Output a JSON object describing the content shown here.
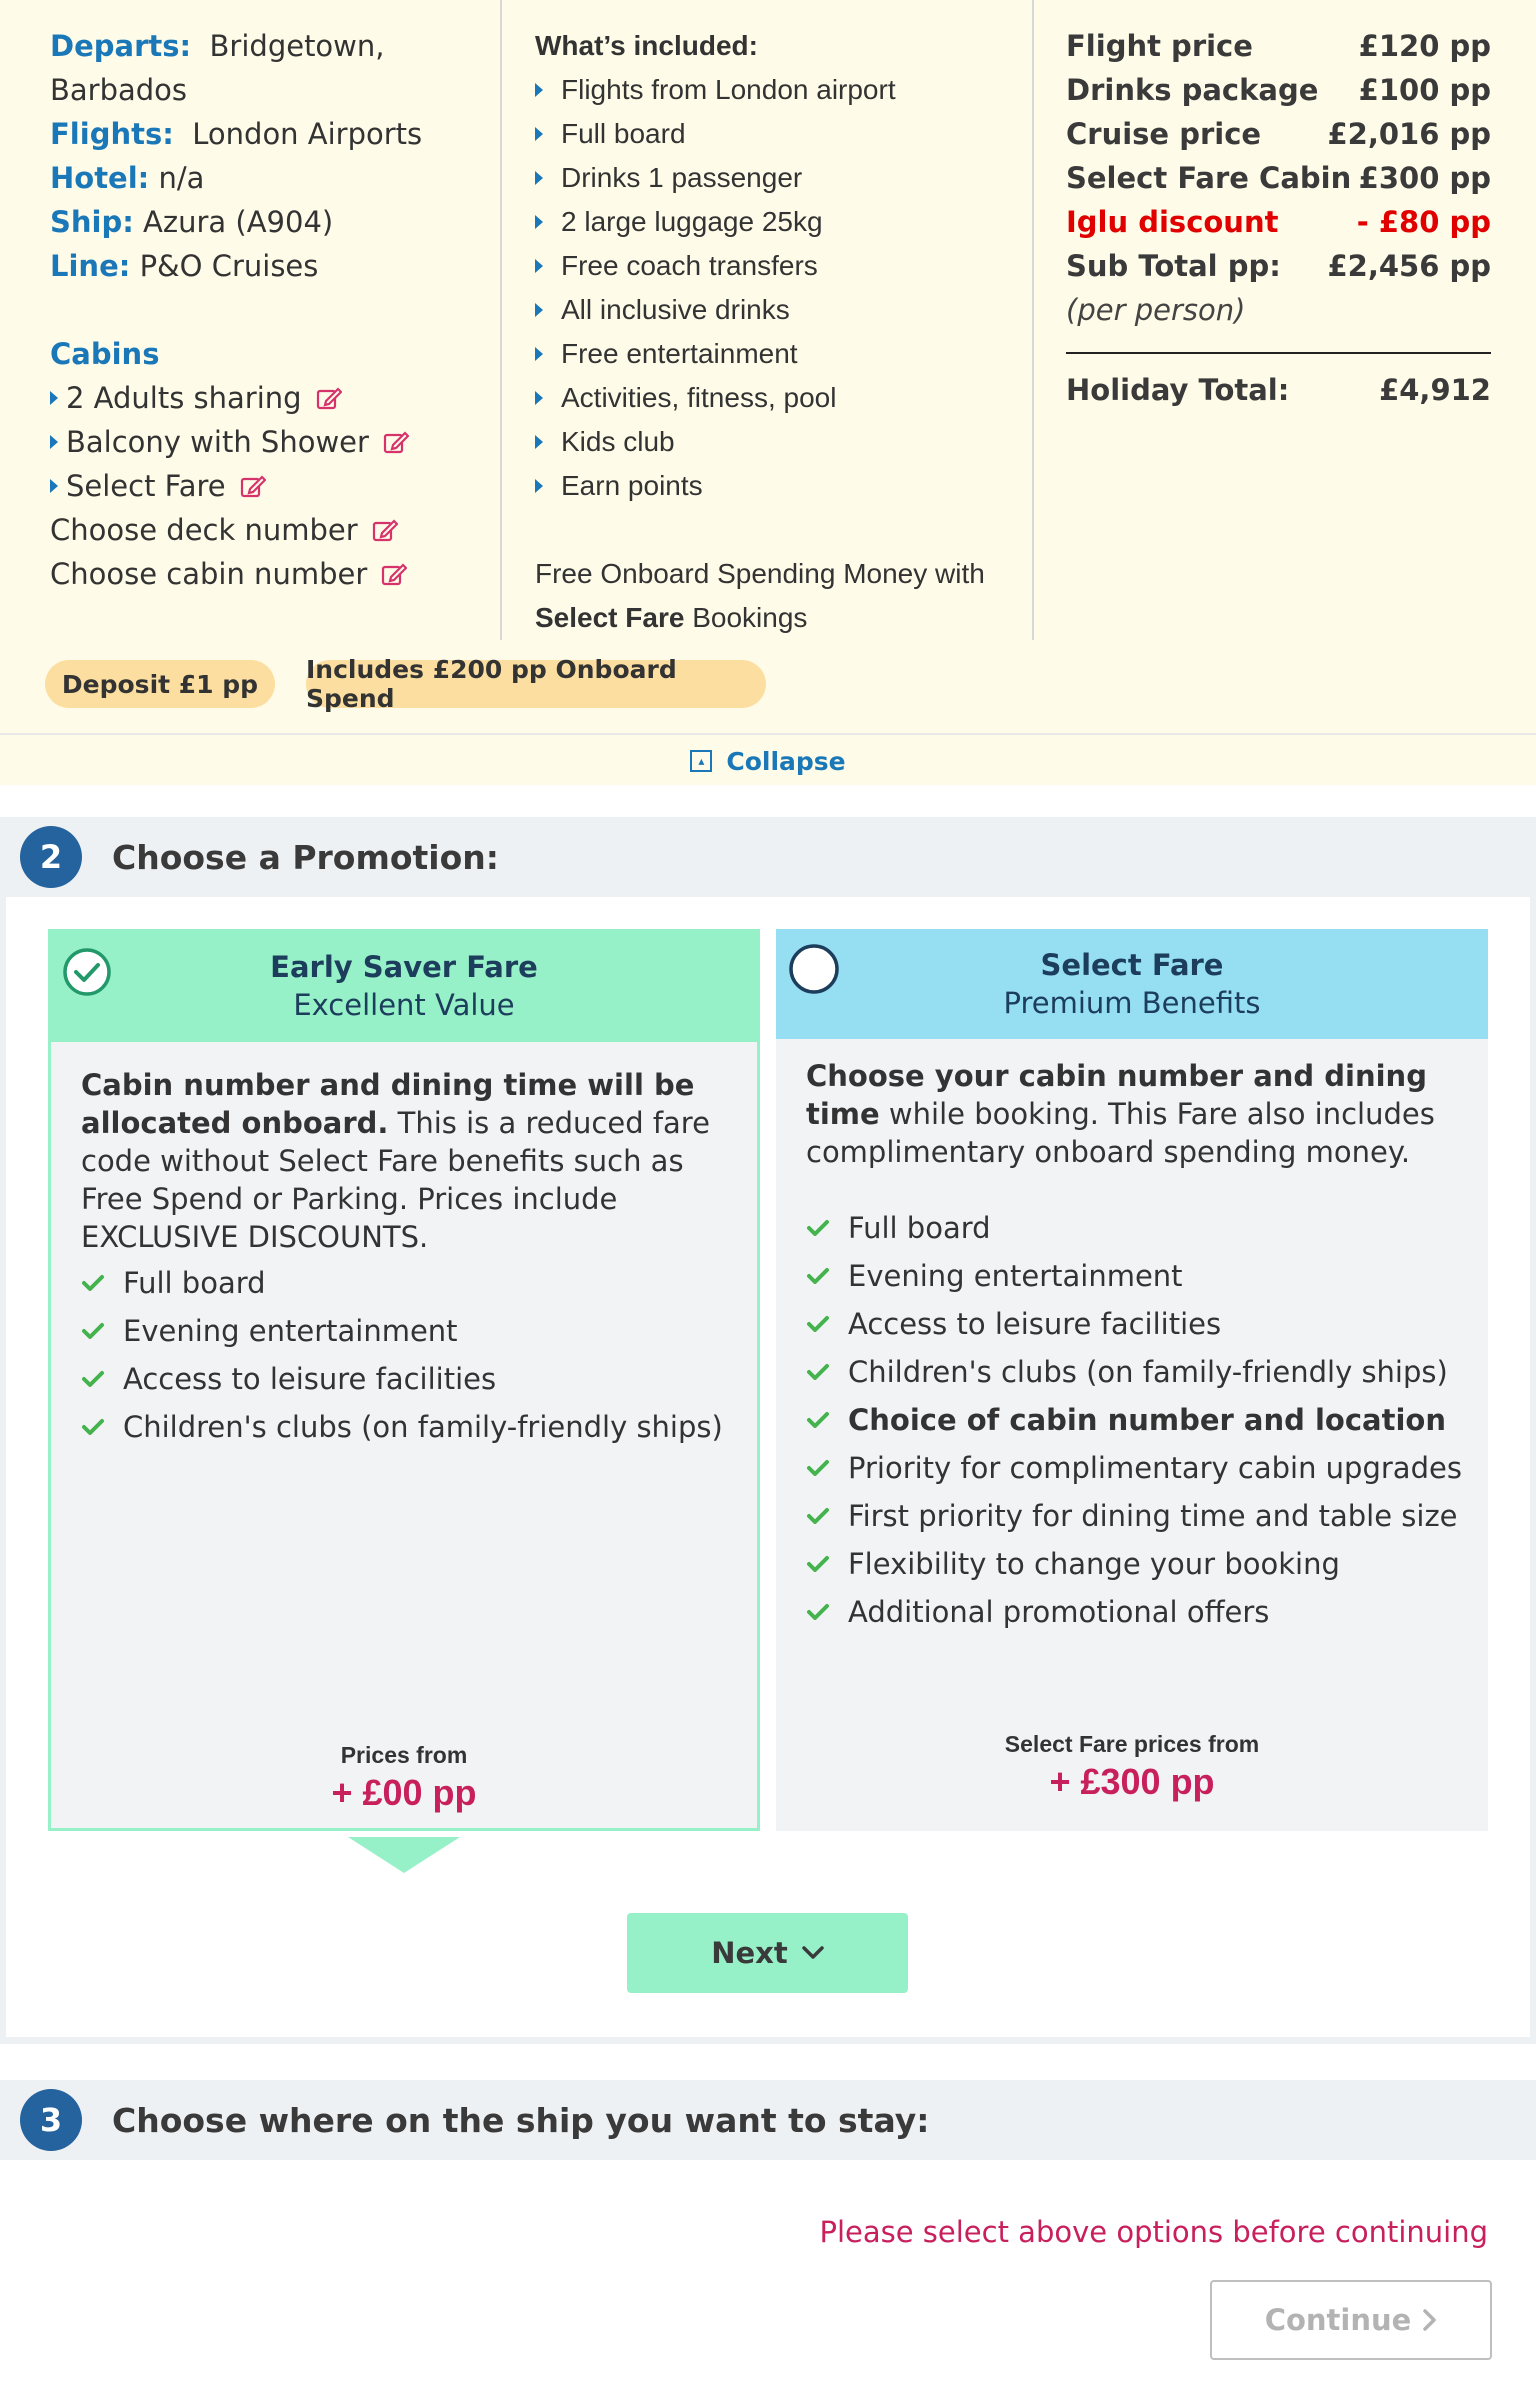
{
  "summary": {
    "details": [
      {
        "label": "Departs:",
        "value": "Bridgetown, Barbados"
      },
      {
        "label": "Flights:",
        "value": "London Airports"
      },
      {
        "label": "Hotel:",
        "value": "n/a"
      },
      {
        "label": "Ship:",
        "value": "Azura (A904)"
      },
      {
        "label": "Line:",
        "value": "P&O Cruises"
      }
    ],
    "cabins_title": "Cabins",
    "cabins": [
      "2 Adults sharing",
      "Balcony with Shower",
      "Select Fare",
      "Choose deck number",
      "Choose cabin number"
    ],
    "included_title": "What’s included:",
    "included": [
      "Flights from London airport",
      "Full board",
      "Drinks 1 passenger",
      "2 large luggage 25kg",
      "Free coach transfers",
      "All inclusive drinks",
      "Free entertainment",
      "Activities, fitness, pool",
      "Kids club",
      "Earn points"
    ],
    "onboard_note_1": "Free Onboard Spending Money with",
    "onboard_note_bold": "Select Fare",
    "onboard_note_2": " Bookings",
    "prices": [
      {
        "label": "Flight price",
        "value": "£120 pp"
      },
      {
        "label": "Drinks package",
        "value": "£100 pp"
      },
      {
        "label": "Cruise price",
        "value": "£2,016 pp"
      },
      {
        "label": "Select Fare Cabin",
        "value": "£300 pp"
      },
      {
        "label": "Iglu discount",
        "value": "- £80 pp"
      },
      {
        "label": "Sub Total pp:",
        "value": "£2,456 pp"
      }
    ],
    "per_person": "(per person)",
    "holiday_total_label": "Holiday Total:",
    "holiday_total_value": "£4,912",
    "deposit_pill": "Deposit £1 pp",
    "onboard_pill": "Includes £200 pp Onboard Spend",
    "collapse_label": "Collapse"
  },
  "step2": {
    "number": "2",
    "title": "Choose a Promotion:",
    "early": {
      "name": "Early Saver Fare",
      "subtitle": "Excellent Value",
      "desc_bold": "Cabin number and dining time will be allocated onboard.",
      "desc_rest": " This is a reduced fare code without Select Fare benefits such as Free Spend or Parking. Prices include EXCLUSIVE DISCOUNTS.",
      "features": [
        "Full board",
        "Evening entertainment",
        "Access to leisure facilities",
        "Children's clubs (on family-friendly ships)"
      ],
      "price_label": "Prices from",
      "price_value": "+ £00 pp"
    },
    "select": {
      "name": "Select Fare",
      "subtitle": "Premium Benefits",
      "desc_bold": "Choose your cabin number and dining time",
      "desc_rest": " while booking. This Fare also includes complimentary onboard spending money.",
      "features": [
        "Full board",
        "Evening entertainment",
        "Access to leisure facilities",
        "Children's clubs (on family-friendly ships)",
        "Choice of cabin number and location",
        "Priority for complimentary cabin upgrades",
        "First priority for dining time and table size",
        "Flexibility to change your booking",
        "Additional promotional offers"
      ],
      "price_label": "Select Fare prices from",
      "price_value": "+ £300 pp"
    },
    "next_label": "Next"
  },
  "step3": {
    "number": "3",
    "title": "Choose where on the ship you want to stay:",
    "warning": "Please select above options before continuing",
    "continue_label": "Continue"
  },
  "colors": {
    "accent_blue": "#1a78b8",
    "early_header": "#96f0c8",
    "select_header": "#96def2",
    "price_pink": "#c8205c",
    "discount_red": "#e00000",
    "summary_bg": "#fefbe8"
  }
}
